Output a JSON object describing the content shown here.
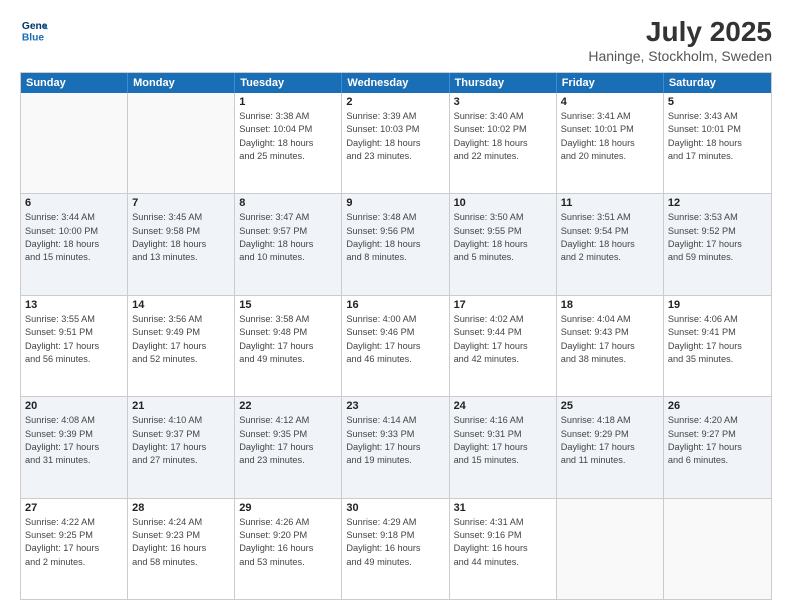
{
  "header": {
    "logo_line1": "General",
    "logo_line2": "Blue",
    "title": "July 2025",
    "subtitle": "Haninge, Stockholm, Sweden"
  },
  "dayNames": [
    "Sunday",
    "Monday",
    "Tuesday",
    "Wednesday",
    "Thursday",
    "Friday",
    "Saturday"
  ],
  "weeks": [
    [
      {
        "day": "",
        "info": ""
      },
      {
        "day": "",
        "info": ""
      },
      {
        "day": "1",
        "info": "Sunrise: 3:38 AM\nSunset: 10:04 PM\nDaylight: 18 hours\nand 25 minutes."
      },
      {
        "day": "2",
        "info": "Sunrise: 3:39 AM\nSunset: 10:03 PM\nDaylight: 18 hours\nand 23 minutes."
      },
      {
        "day": "3",
        "info": "Sunrise: 3:40 AM\nSunset: 10:02 PM\nDaylight: 18 hours\nand 22 minutes."
      },
      {
        "day": "4",
        "info": "Sunrise: 3:41 AM\nSunset: 10:01 PM\nDaylight: 18 hours\nand 20 minutes."
      },
      {
        "day": "5",
        "info": "Sunrise: 3:43 AM\nSunset: 10:01 PM\nDaylight: 18 hours\nand 17 minutes."
      }
    ],
    [
      {
        "day": "6",
        "info": "Sunrise: 3:44 AM\nSunset: 10:00 PM\nDaylight: 18 hours\nand 15 minutes."
      },
      {
        "day": "7",
        "info": "Sunrise: 3:45 AM\nSunset: 9:58 PM\nDaylight: 18 hours\nand 13 minutes."
      },
      {
        "day": "8",
        "info": "Sunrise: 3:47 AM\nSunset: 9:57 PM\nDaylight: 18 hours\nand 10 minutes."
      },
      {
        "day": "9",
        "info": "Sunrise: 3:48 AM\nSunset: 9:56 PM\nDaylight: 18 hours\nand 8 minutes."
      },
      {
        "day": "10",
        "info": "Sunrise: 3:50 AM\nSunset: 9:55 PM\nDaylight: 18 hours\nand 5 minutes."
      },
      {
        "day": "11",
        "info": "Sunrise: 3:51 AM\nSunset: 9:54 PM\nDaylight: 18 hours\nand 2 minutes."
      },
      {
        "day": "12",
        "info": "Sunrise: 3:53 AM\nSunset: 9:52 PM\nDaylight: 17 hours\nand 59 minutes."
      }
    ],
    [
      {
        "day": "13",
        "info": "Sunrise: 3:55 AM\nSunset: 9:51 PM\nDaylight: 17 hours\nand 56 minutes."
      },
      {
        "day": "14",
        "info": "Sunrise: 3:56 AM\nSunset: 9:49 PM\nDaylight: 17 hours\nand 52 minutes."
      },
      {
        "day": "15",
        "info": "Sunrise: 3:58 AM\nSunset: 9:48 PM\nDaylight: 17 hours\nand 49 minutes."
      },
      {
        "day": "16",
        "info": "Sunrise: 4:00 AM\nSunset: 9:46 PM\nDaylight: 17 hours\nand 46 minutes."
      },
      {
        "day": "17",
        "info": "Sunrise: 4:02 AM\nSunset: 9:44 PM\nDaylight: 17 hours\nand 42 minutes."
      },
      {
        "day": "18",
        "info": "Sunrise: 4:04 AM\nSunset: 9:43 PM\nDaylight: 17 hours\nand 38 minutes."
      },
      {
        "day": "19",
        "info": "Sunrise: 4:06 AM\nSunset: 9:41 PM\nDaylight: 17 hours\nand 35 minutes."
      }
    ],
    [
      {
        "day": "20",
        "info": "Sunrise: 4:08 AM\nSunset: 9:39 PM\nDaylight: 17 hours\nand 31 minutes."
      },
      {
        "day": "21",
        "info": "Sunrise: 4:10 AM\nSunset: 9:37 PM\nDaylight: 17 hours\nand 27 minutes."
      },
      {
        "day": "22",
        "info": "Sunrise: 4:12 AM\nSunset: 9:35 PM\nDaylight: 17 hours\nand 23 minutes."
      },
      {
        "day": "23",
        "info": "Sunrise: 4:14 AM\nSunset: 9:33 PM\nDaylight: 17 hours\nand 19 minutes."
      },
      {
        "day": "24",
        "info": "Sunrise: 4:16 AM\nSunset: 9:31 PM\nDaylight: 17 hours\nand 15 minutes."
      },
      {
        "day": "25",
        "info": "Sunrise: 4:18 AM\nSunset: 9:29 PM\nDaylight: 17 hours\nand 11 minutes."
      },
      {
        "day": "26",
        "info": "Sunrise: 4:20 AM\nSunset: 9:27 PM\nDaylight: 17 hours\nand 6 minutes."
      }
    ],
    [
      {
        "day": "27",
        "info": "Sunrise: 4:22 AM\nSunset: 9:25 PM\nDaylight: 17 hours\nand 2 minutes."
      },
      {
        "day": "28",
        "info": "Sunrise: 4:24 AM\nSunset: 9:23 PM\nDaylight: 16 hours\nand 58 minutes."
      },
      {
        "day": "29",
        "info": "Sunrise: 4:26 AM\nSunset: 9:20 PM\nDaylight: 16 hours\nand 53 minutes."
      },
      {
        "day": "30",
        "info": "Sunrise: 4:29 AM\nSunset: 9:18 PM\nDaylight: 16 hours\nand 49 minutes."
      },
      {
        "day": "31",
        "info": "Sunrise: 4:31 AM\nSunset: 9:16 PM\nDaylight: 16 hours\nand 44 minutes."
      },
      {
        "day": "",
        "info": ""
      },
      {
        "day": "",
        "info": ""
      }
    ]
  ]
}
